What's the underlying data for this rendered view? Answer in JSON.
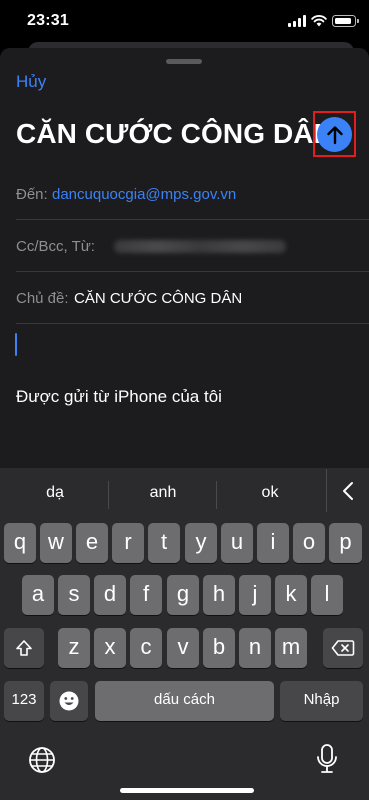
{
  "status": {
    "time": "23:31"
  },
  "compose": {
    "cancel_label": "Hủy",
    "title": "CĂN CƯỚC CÔNG DÂN",
    "to_label": "Đến:",
    "to_value": "dancuquocgia@mps.gov.vn",
    "cc_label": "Cc/Bcc, Từ:",
    "subject_label": "Chủ đề:",
    "subject_value": "CĂN CƯỚC CÔNG DÂN",
    "signature": "Được gửi từ iPhone của tôi",
    "accent_color": "#3b82f6",
    "highlight_color": "#e11d1d"
  },
  "keyboard": {
    "suggestions": [
      "dạ",
      "anh",
      "ok"
    ],
    "row1": [
      "q",
      "w",
      "e",
      "r",
      "t",
      "y",
      "u",
      "i",
      "o",
      "p"
    ],
    "row2": [
      "a",
      "s",
      "d",
      "f",
      "g",
      "h",
      "j",
      "k",
      "l"
    ],
    "row3": [
      "z",
      "x",
      "c",
      "v",
      "b",
      "n",
      "m"
    ],
    "numbers_label": "123",
    "space_label": "dấu cách",
    "return_label": "Nhập",
    "icons": [
      "shift-icon",
      "backspace-icon",
      "emoji-icon",
      "globe-icon",
      "microphone-icon",
      "chevron-left-icon",
      "arrow-up-icon"
    ]
  }
}
